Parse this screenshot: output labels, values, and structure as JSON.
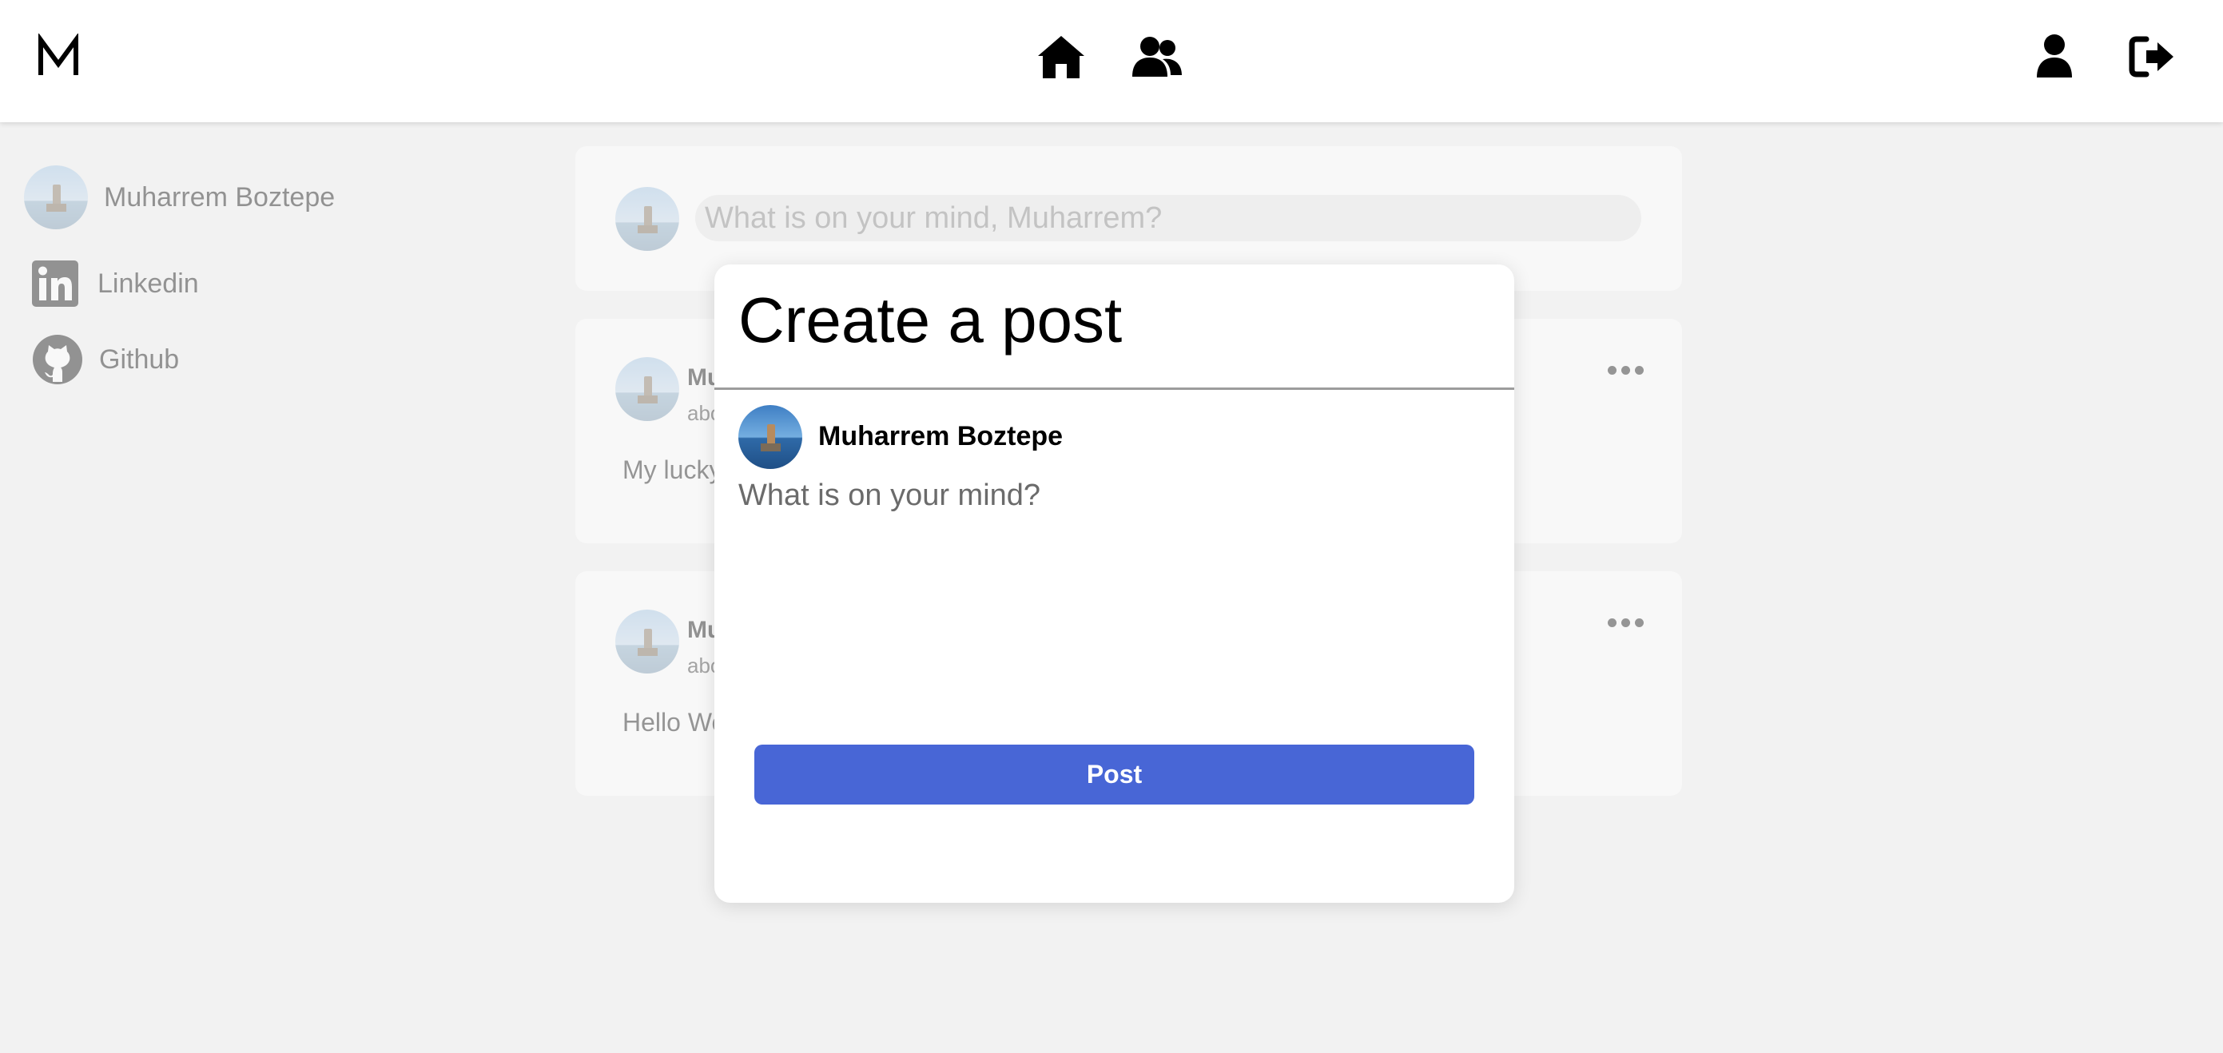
{
  "navbar": {
    "logo_icon": "m-logo-icon",
    "icons": [
      "home-icon",
      "friends-icon",
      "profile-icon",
      "logout-icon"
    ]
  },
  "sidebar": {
    "items": [
      {
        "label": "Muharrem Boztepe",
        "icon": "avatar"
      },
      {
        "label": "Linkedin",
        "icon": "linkedin-icon"
      },
      {
        "label": "Github",
        "icon": "github-icon"
      }
    ]
  },
  "composer": {
    "placeholder": "What is on your mind, Muharrem?"
  },
  "feed": {
    "posts": [
      {
        "author_visible": "Mu",
        "time_visible": "abo",
        "text_visible": "My lucky"
      },
      {
        "author_visible": "Mu",
        "time_visible": "abo",
        "text_visible": "Hello Wo"
      }
    ]
  },
  "modal": {
    "title": "Create a post",
    "author": "Muharrem Boztepe",
    "textarea_placeholder": "What is on your mind?",
    "textarea_value": "",
    "post_button_label": "Post"
  },
  "colors": {
    "accent": "#4866d6",
    "background": "#f2f2f2"
  }
}
